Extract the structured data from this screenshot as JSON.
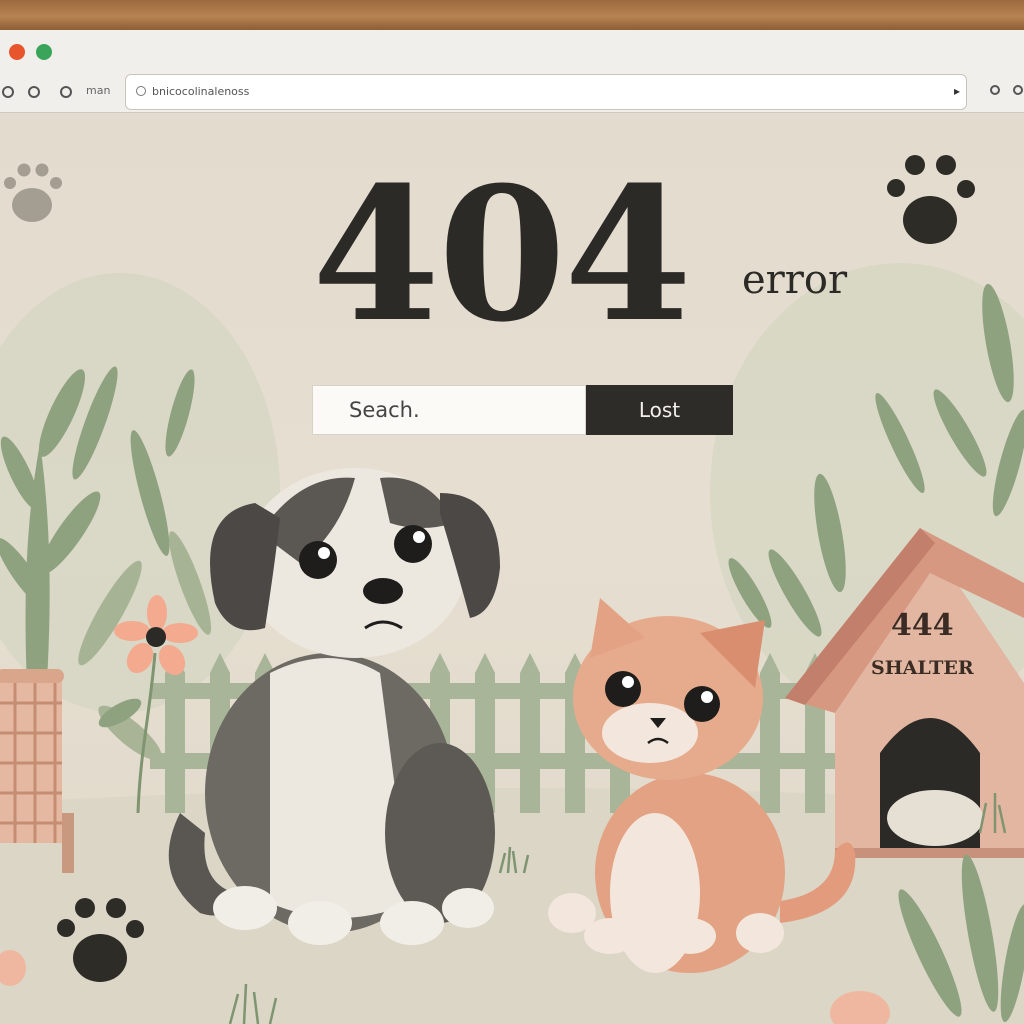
{
  "browser": {
    "nav_label": "man",
    "url": "bnicocolinalenoss"
  },
  "page": {
    "title": "404",
    "title_suffix": "error",
    "search_placeholder": "Seach.",
    "search_button": "Lost",
    "shelter_number": "444",
    "shelter_label": "SHALTER"
  },
  "colors": {
    "background": "#e6dfd1",
    "text": "#2b2a26",
    "button": "#2d2c28",
    "foliage": "#97a785",
    "kennel": "#d8a083"
  }
}
